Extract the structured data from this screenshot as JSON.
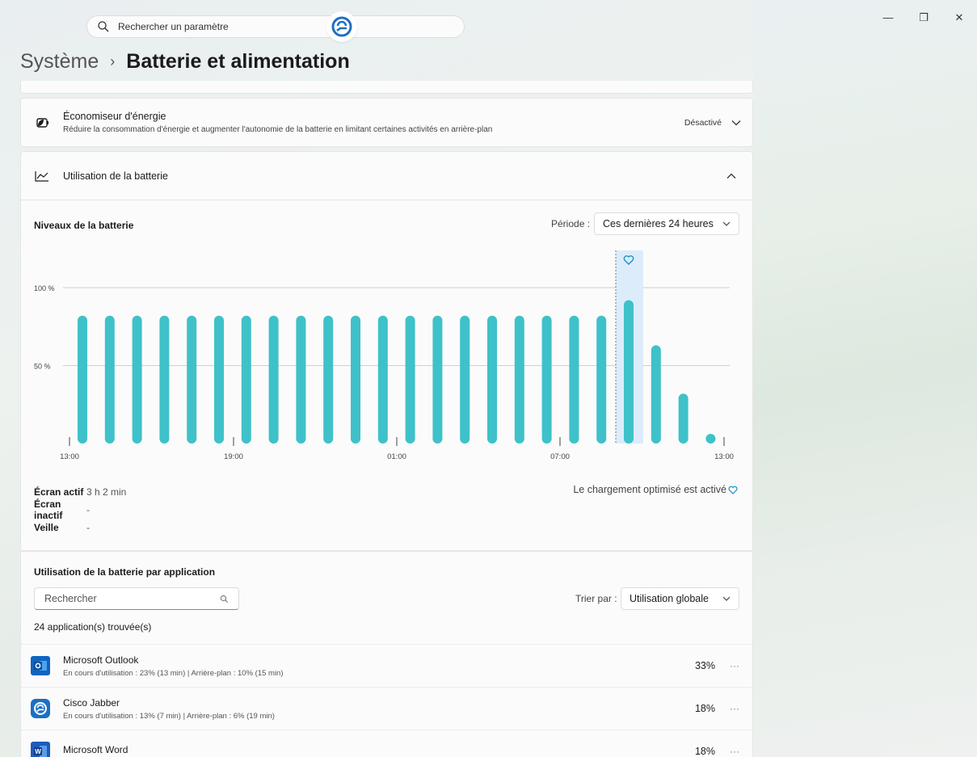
{
  "window": {
    "controls": [
      "—",
      "❐",
      "✕"
    ]
  },
  "search": {
    "placeholder": "Rechercher un paramètre"
  },
  "breadcrumb": {
    "parent": "Système",
    "current": "Batterie et alimentation"
  },
  "energy_saver": {
    "title": "Économiseur d'énergie",
    "description": "Réduire la consommation d'énergie et augmenter l'autonomie de la batterie en limitant certaines activités en arrière-plan",
    "status": "Désactivé"
  },
  "battery_usage": {
    "header": "Utilisation de la batterie",
    "levels_title": "Niveaux de la batterie",
    "period_label": "Période :",
    "period_value": "Ces dernières 24 heures"
  },
  "chart_data": {
    "type": "bar",
    "y_tick_labels": [
      "100 %",
      "50 %"
    ],
    "y_ticks": [
      100,
      50
    ],
    "ylim": [
      0,
      100
    ],
    "x_tick_labels": [
      "13:00",
      "19:00",
      "01:00",
      "07:00",
      "13:00"
    ],
    "values": [
      82,
      82,
      82,
      82,
      82,
      82,
      82,
      82,
      82,
      82,
      82,
      82,
      82,
      82,
      82,
      82,
      82,
      82,
      82,
      82,
      92,
      63,
      32,
      5
    ],
    "charging_index": 20,
    "bar_color": "#3fc1c9",
    "highlight_color": "#dcecfb"
  },
  "stats": [
    {
      "label": "Écran actif",
      "value": "3 h 2 min"
    },
    {
      "label": "Écran inactif",
      "value": "-"
    },
    {
      "label": "Veille",
      "value": "-"
    }
  ],
  "optimized_charging": "Le chargement optimisé est activé",
  "apps": {
    "title": "Utilisation de la batterie par application",
    "search_placeholder": "Rechercher",
    "sort_label": "Trier par :",
    "sort_value": "Utilisation globale",
    "count": "24 application(s) trouvée(s)",
    "items": [
      {
        "name": "Microsoft Outlook",
        "detail": "En cours d'utilisation : 23% (13 min) | Arrière-plan : 10% (15 min)",
        "percent": "33%",
        "icon": "outlook-icon"
      },
      {
        "name": "Cisco Jabber",
        "detail": "En cours d'utilisation : 13% (7 min) | Arrière-plan : 6% (19 min)",
        "percent": "18%",
        "icon": "jabber-icon"
      },
      {
        "name": "Microsoft Word",
        "detail": "",
        "percent": "18%",
        "icon": "word-icon"
      }
    ]
  }
}
